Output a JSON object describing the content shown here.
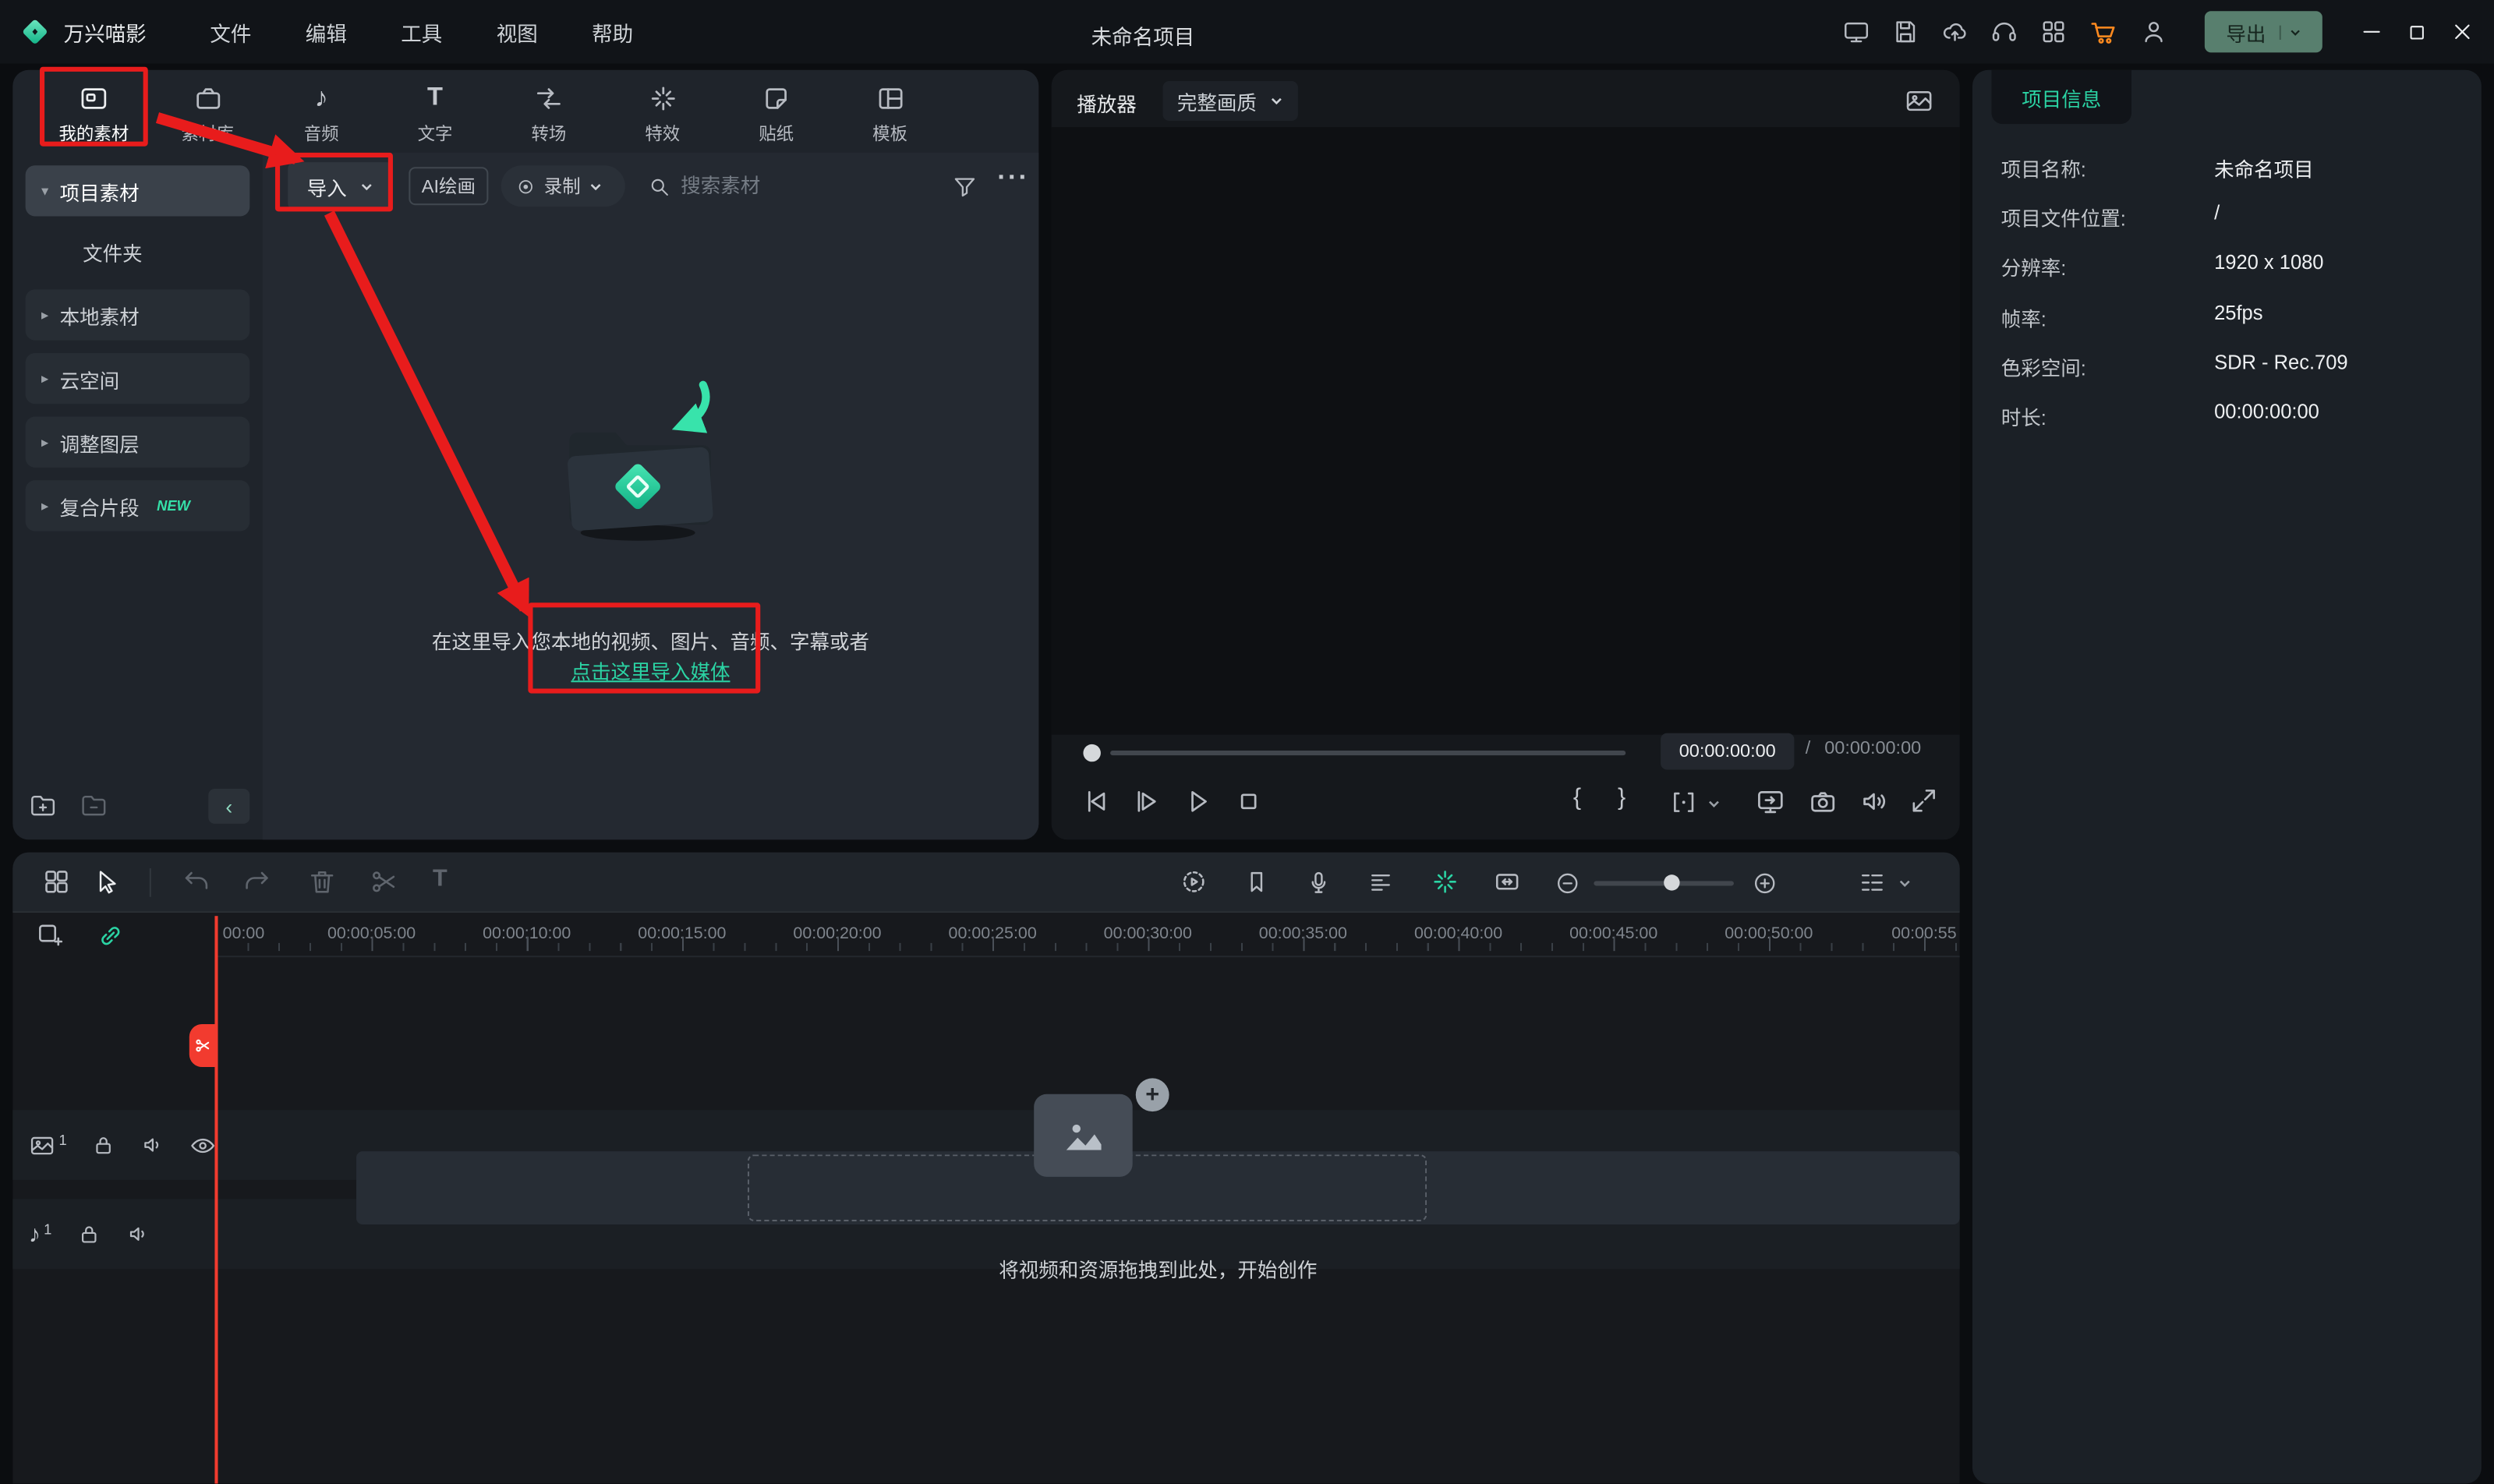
{
  "colors": {
    "accent": "#2bd4a4",
    "annotation": "#e81c1c"
  },
  "glyphs": {
    "caret_down": "▾",
    "caret_right": "▸",
    "more": "···",
    "note": "♪",
    "text_tool": "T",
    "brace_open": "{",
    "brace_close": "}",
    "plus": "+",
    "minus": "−",
    "collapse": "‹"
  },
  "titlebar": {
    "app_name": "万兴喵影",
    "menus": [
      "文件",
      "编辑",
      "工具",
      "视图",
      "帮助"
    ],
    "project_title": "未命名项目",
    "export_label": "导出"
  },
  "media_panel": {
    "tabs": [
      {
        "label": "我的素材"
      },
      {
        "label": "素材库"
      },
      {
        "label": "音频"
      },
      {
        "label": "文字"
      },
      {
        "label": "转场"
      },
      {
        "label": "特效"
      },
      {
        "label": "贴纸"
      },
      {
        "label": "模板"
      }
    ],
    "sidebar": {
      "items": [
        {
          "label": "项目素材"
        },
        {
          "label": "文件夹"
        },
        {
          "label": "本地素材"
        },
        {
          "label": "云空间"
        },
        {
          "label": "调整图层"
        },
        {
          "label": "复合片段",
          "badge": "NEW"
        }
      ]
    },
    "toolbar": {
      "import": "导入",
      "ai_paint": "AI绘画",
      "record": "录制",
      "search_placeholder": "搜索素材"
    },
    "empty": {
      "line1": "在这里导入您本地的视频、图片、音频、字幕或者",
      "link": "点击这里导入媒体"
    }
  },
  "preview": {
    "player_label": "播放器",
    "quality": "完整画质",
    "current_time": "00:00:00:00",
    "time_separator": "/",
    "total_time": "00:00:00:00"
  },
  "project_info": {
    "tab": "项目信息",
    "rows": [
      {
        "label": "项目名称:",
        "value": "未命名项目"
      },
      {
        "label": "项目文件位置:",
        "value": "/"
      },
      {
        "label": "分辨率:",
        "value": "1920 x 1080"
      },
      {
        "label": "帧率:",
        "value": "25fps"
      },
      {
        "label": "色彩空间:",
        "value": "SDR - Rec.709"
      },
      {
        "label": "时长:",
        "value": "00:00:00:00"
      }
    ]
  },
  "timeline": {
    "ticks": [
      "00:00",
      "00:00:05:00",
      "00:00:10:00",
      "00:00:15:00",
      "00:00:20:00",
      "00:00:25:00",
      "00:00:30:00",
      "00:00:35:00",
      "00:00:40:00",
      "00:00:45:00",
      "00:00:50:00",
      "00:00:55"
    ],
    "video_track_num": "1",
    "audio_track_num": "1",
    "drop_hint": "将视频和资源拖拽到此处，开始创作"
  }
}
